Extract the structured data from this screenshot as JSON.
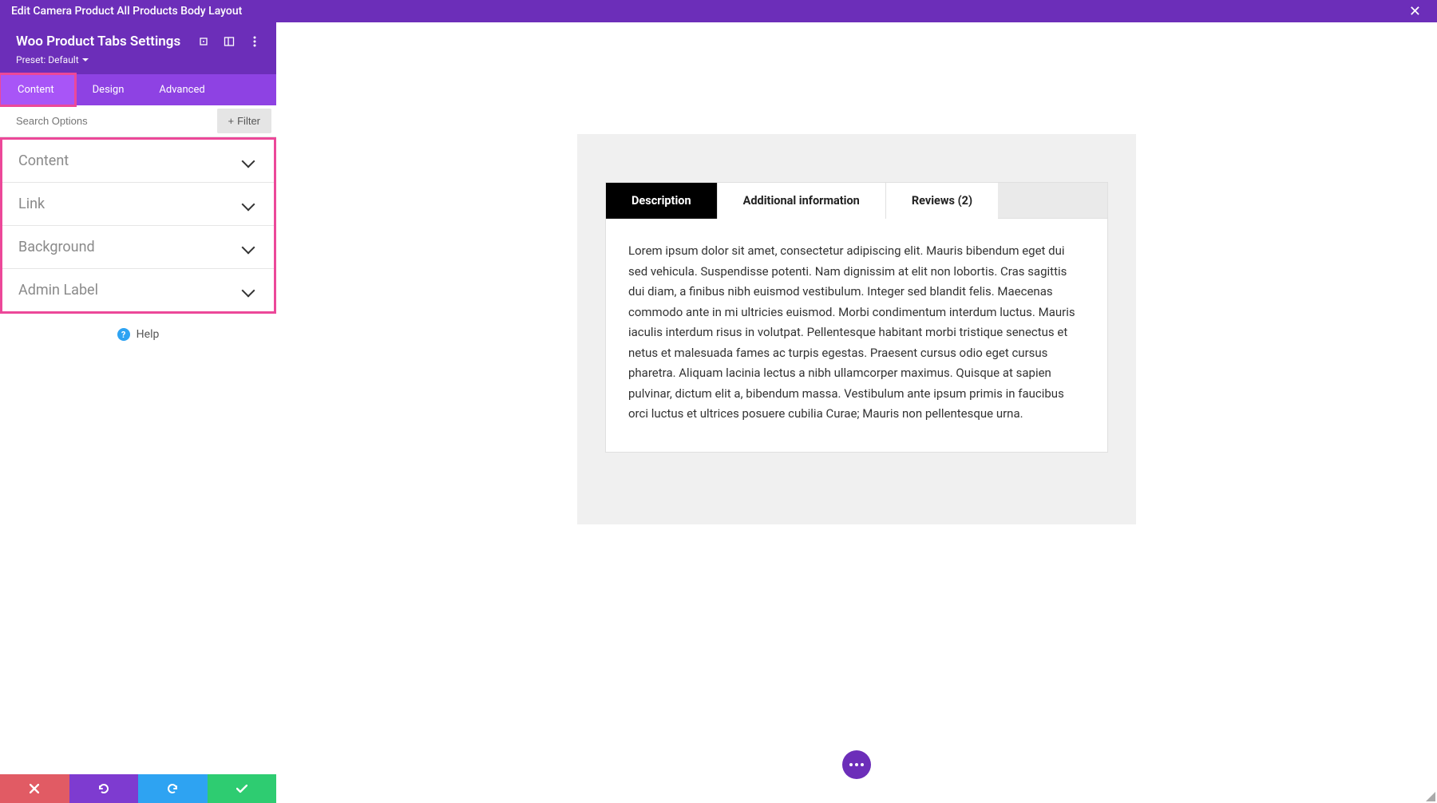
{
  "topbar": {
    "title": "Edit Camera Product All Products Body Layout"
  },
  "sidebar": {
    "panel_title": "Woo Product Tabs Settings",
    "preset_label": "Preset: Default",
    "tabs": {
      "content": "Content",
      "design": "Design",
      "advanced": "Advanced"
    },
    "search_placeholder": "Search Options",
    "filter_label": "Filter",
    "sections": {
      "content": "Content",
      "link": "Link",
      "background": "Background",
      "admin_label": "Admin Label"
    },
    "help_label": "Help"
  },
  "preview": {
    "tabs": {
      "description": "Description",
      "additional_info": "Additional information",
      "reviews": "Reviews (2)"
    },
    "description_body": "Lorem ipsum dolor sit amet, consectetur adipiscing elit. Mauris bibendum eget dui sed vehicula. Suspendisse potenti. Nam dignissim at elit non lobortis. Cras sagittis dui diam, a finibus nibh euismod vestibulum. Integer sed blandit felis. Maecenas commodo ante in mi ultricies euismod. Morbi condimentum interdum luctus. Mauris iaculis interdum risus in volutpat. Pellentesque habitant morbi tristique senectus et netus et malesuada fames ac turpis egestas. Praesent cursus odio eget cursus pharetra. Aliquam lacinia lectus a nibh ullamcorper maximus. Quisque at sapien pulvinar, dictum elit a, bibendum massa. Vestibulum ante ipsum primis in faucibus orci luctus et ultrices posuere cubilia Curae; Mauris non pellentesque urna."
  }
}
